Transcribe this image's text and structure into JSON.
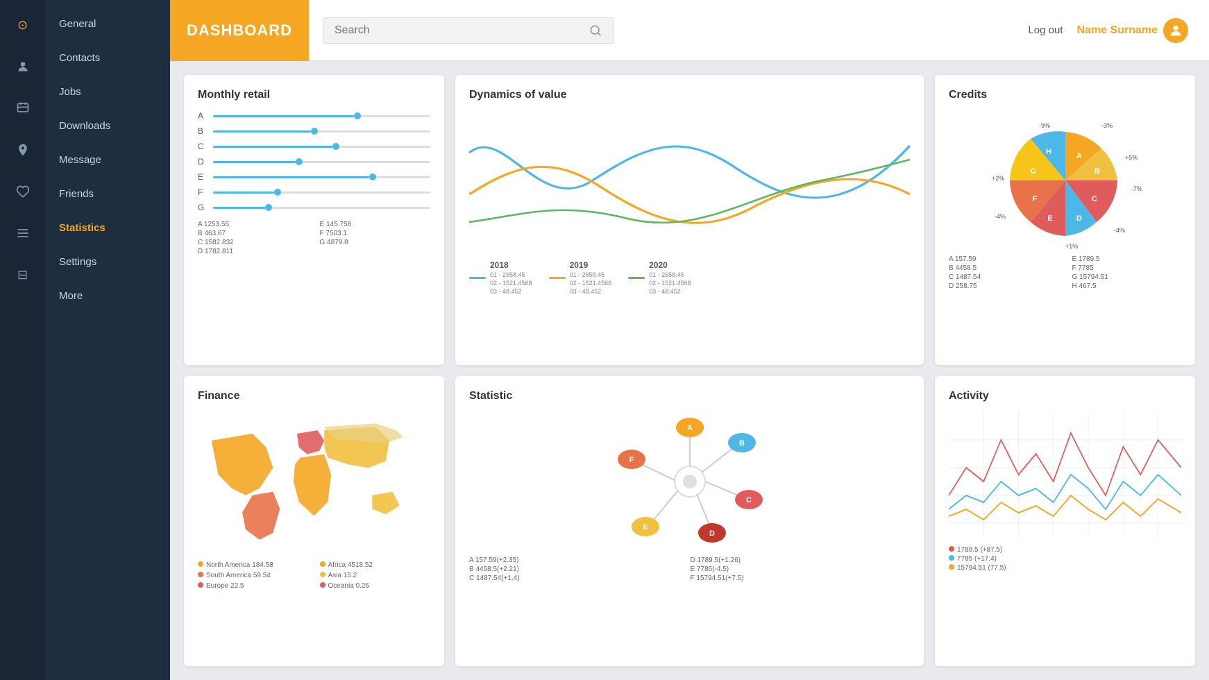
{
  "header": {
    "dashboard_title": "DASHBOARD",
    "search_placeholder": "Search",
    "logout_label": "Log out",
    "user_name": "Name Surname"
  },
  "sidebar": {
    "icons": [
      {
        "name": "general-icon",
        "symbol": "⊙"
      },
      {
        "name": "contacts-icon",
        "symbol": "👤"
      },
      {
        "name": "jobs-icon",
        "symbol": "🗺"
      },
      {
        "name": "location-icon",
        "symbol": "📍"
      },
      {
        "name": "message-icon",
        "symbol": "♡"
      },
      {
        "name": "friends-icon",
        "symbol": "⊞"
      },
      {
        "name": "settings-icon",
        "symbol": "⊟"
      }
    ],
    "nav_items": [
      {
        "label": "General",
        "active": false
      },
      {
        "label": "Contacts",
        "active": false
      },
      {
        "label": "Jobs",
        "active": false
      },
      {
        "label": "Downloads",
        "active": false
      },
      {
        "label": "Message",
        "active": false
      },
      {
        "label": "Friends",
        "active": false
      },
      {
        "label": "Statistics",
        "active": true
      },
      {
        "label": "Settings",
        "active": false
      },
      {
        "label": "More",
        "active": false
      }
    ]
  },
  "cards": {
    "monthly_retail": {
      "title": "Monthly retail",
      "sliders": [
        {
          "label": "A",
          "percent": 65
        },
        {
          "label": "B",
          "percent": 45
        },
        {
          "label": "C",
          "percent": 55
        },
        {
          "label": "D",
          "percent": 40
        },
        {
          "label": "E",
          "percent": 72
        },
        {
          "label": "F",
          "percent": 30
        },
        {
          "label": "G",
          "percent": 28
        }
      ],
      "legend": [
        {
          "key": "A",
          "val": "1253.55"
        },
        {
          "key": "E",
          "val": "145.758"
        },
        {
          "key": "B",
          "val": "463.67"
        },
        {
          "key": "F",
          "val": "7503.1"
        },
        {
          "key": "C",
          "val": "1582.832"
        },
        {
          "key": "G",
          "val": "4879.8"
        },
        {
          "key": "D",
          "val": "1782.811"
        },
        {
          "key": "",
          "val": ""
        }
      ]
    },
    "dynamics": {
      "title": "Dynamics of value",
      "legend": [
        {
          "year": "2018",
          "color": "#4db8e8",
          "detail1": "01 - 2658.45",
          "detail2": "02 - 1521.4568",
          "detail3": "03 - 48.452"
        },
        {
          "year": "2019",
          "color": "#f5a623",
          "detail1": "01 - 2658.45",
          "detail2": "02 - 1521.4568",
          "detail3": "03 - 48.452"
        },
        {
          "year": "2020",
          "color": "#5cb85c",
          "detail1": "01 - 2658.45",
          "detail2": "02 - 1521.4568",
          "detail3": "03 - 48.452"
        }
      ]
    },
    "credits": {
      "title": "Credits",
      "segments": [
        {
          "label": "A",
          "color": "#f5a623",
          "pct": "-9%",
          "val": "157.59"
        },
        {
          "label": "B",
          "color": "#f5a623",
          "pct": "-3%",
          "val": "4458.5"
        },
        {
          "label": "C",
          "color": "#e05c5c",
          "pct": "+5%",
          "val": "1487.54"
        },
        {
          "label": "D",
          "color": "#4db8e8",
          "pct": "-7%",
          "val": "258.75"
        },
        {
          "label": "E",
          "color": "#e05c5c",
          "pct": "+1%",
          "val": ""
        },
        {
          "label": "F",
          "color": "#e8734a",
          "pct": "-4%",
          "val": "7785"
        },
        {
          "label": "G",
          "color": "#f5a623",
          "pct": "+2%",
          "val": "15794.51"
        },
        {
          "label": "H",
          "color": "#4db8e8",
          "pct": "",
          "val": "467.5"
        }
      ],
      "legend": [
        {
          "key": "A",
          "val": "157.59"
        },
        {
          "key": "E",
          "val": "1789.5"
        },
        {
          "key": "B",
          "val": "4458.5"
        },
        {
          "key": "F",
          "val": "7785"
        },
        {
          "key": "C",
          "val": "1487.54"
        },
        {
          "key": "G",
          "val": "15794.51"
        },
        {
          "key": "D",
          "val": "258.75"
        },
        {
          "key": "H",
          "val": "467.5"
        }
      ]
    },
    "finance": {
      "title": "Finance",
      "legend": [
        {
          "label": "North America",
          "val": "184.58",
          "color": "#f5a623"
        },
        {
          "label": "Africa",
          "val": "4518.52",
          "color": "#f5a623"
        },
        {
          "label": "South America",
          "val": "59.54",
          "color": "#e8734a"
        },
        {
          "label": "Asia",
          "val": "15.2",
          "color": "#f0c040"
        },
        {
          "label": "Europe",
          "val": "22.5",
          "color": "#e05c5c"
        },
        {
          "label": "Oceania",
          "val": "0.26",
          "color": "#e05c5c"
        }
      ]
    },
    "statistic": {
      "title": "Statistic",
      "nodes": [
        {
          "label": "A",
          "color": "#f5a623",
          "angle": -90
        },
        {
          "label": "B",
          "color": "#4db8e8",
          "angle": -20
        },
        {
          "label": "C",
          "color": "#e05c5c",
          "angle": 40
        },
        {
          "label": "D",
          "color": "#c0392b",
          "angle": 110
        },
        {
          "label": "E",
          "color": "#f0c040",
          "angle": 160
        },
        {
          "label": "F",
          "color": "#e8734a",
          "angle": -150
        }
      ],
      "legend": [
        {
          "key": "A",
          "val": "157.59(+2.35)"
        },
        {
          "key": "D",
          "val": "1789.5(+1.26)"
        },
        {
          "key": "B",
          "val": "4458.5(+2.21)"
        },
        {
          "key": "E",
          "val": "7785(-4.5)"
        },
        {
          "key": "C",
          "val": "1487.54(+1.4)"
        },
        {
          "key": "F",
          "val": "15794.51(+7.5)"
        }
      ]
    },
    "activity": {
      "title": "Activity",
      "legend": [
        {
          "val": "1789.5 (+87.5)",
          "color": "#e05c5c"
        },
        {
          "val": "7785 (+17.4)",
          "color": "#4db8e8"
        },
        {
          "val": "15794.51 (77.5)",
          "color": "#f5a623"
        }
      ]
    }
  }
}
